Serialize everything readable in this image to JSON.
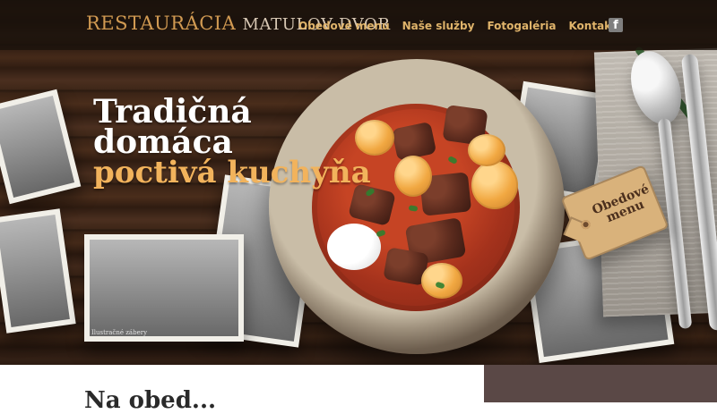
{
  "brand": {
    "logo_main": "RESTAURÁCIA",
    "logo_sub": "MATULOV DVOR"
  },
  "nav": {
    "items": [
      {
        "label": "Obedové menu"
      },
      {
        "label": "Naše služby"
      },
      {
        "label": "Fotogaléria"
      },
      {
        "label": "Kontakt"
      }
    ],
    "social": {
      "facebook_label": "f"
    }
  },
  "hero": {
    "headline_line1": "Tradičná",
    "headline_line2": "domáca",
    "headline_line3": "poctivá kuchyňa",
    "tag_label_line1": "Obedové",
    "tag_label_line2": "menu",
    "photo_caption": "Ilustračné zábery"
  },
  "content": {
    "section_title": "Na obed..."
  },
  "colors": {
    "accent": "#f2b35c",
    "nav_accent": "#e0b46b",
    "footer_block": "#5a4846"
  }
}
